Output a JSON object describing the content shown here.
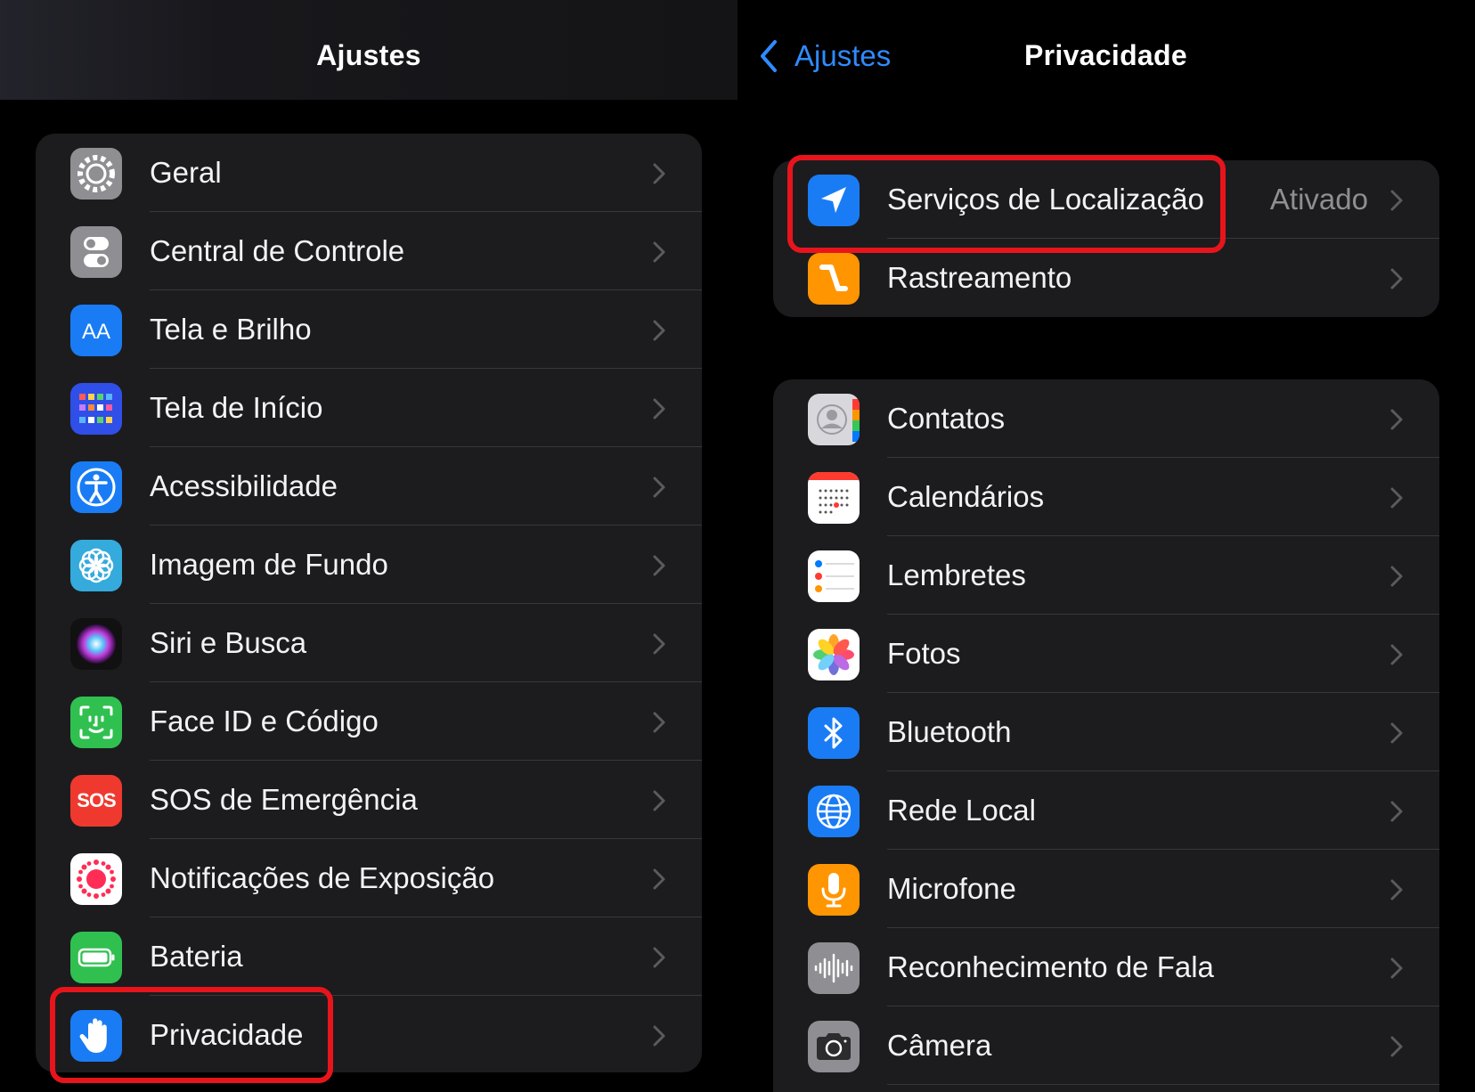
{
  "left": {
    "title": "Ajustes",
    "rows": [
      {
        "label": "Geral",
        "icon": "gear-icon"
      },
      {
        "label": "Central de Controle",
        "icon": "toggles-icon"
      },
      {
        "label": "Tela e Brilho",
        "icon": "text-size-icon"
      },
      {
        "label": "Tela de Início",
        "icon": "home-grid-icon"
      },
      {
        "label": "Acessibilidade",
        "icon": "accessibility-icon"
      },
      {
        "label": "Imagem de Fundo",
        "icon": "flower-icon"
      },
      {
        "label": "Siri e Busca",
        "icon": "siri-icon"
      },
      {
        "label": "Face ID e Código",
        "icon": "face-id-icon"
      },
      {
        "label": "SOS de Emergência",
        "icon": "sos-icon",
        "icon_text": "SOS"
      },
      {
        "label": "Notificações de Exposição",
        "icon": "exposure-icon"
      },
      {
        "label": "Bateria",
        "icon": "battery-icon"
      },
      {
        "label": "Privacidade",
        "icon": "hand-icon"
      }
    ]
  },
  "right": {
    "back_label": "Ajustes",
    "title": "Privacidade",
    "group1": [
      {
        "label": "Serviços de Localização",
        "value": "Ativado",
        "icon": "location-arrow-icon"
      },
      {
        "label": "Rastreamento",
        "icon": "tracking-icon"
      }
    ],
    "group2": [
      {
        "label": "Contatos",
        "icon": "contacts-icon"
      },
      {
        "label": "Calendários",
        "icon": "calendar-icon"
      },
      {
        "label": "Lembretes",
        "icon": "reminders-icon"
      },
      {
        "label": "Fotos",
        "icon": "photos-icon"
      },
      {
        "label": "Bluetooth",
        "icon": "bluetooth-icon"
      },
      {
        "label": "Rede Local",
        "icon": "globe-icon"
      },
      {
        "label": "Microfone",
        "icon": "microphone-icon"
      },
      {
        "label": "Reconhecimento de Fala",
        "icon": "waveform-icon"
      },
      {
        "label": "Câmera",
        "icon": "camera-icon"
      }
    ]
  },
  "colors": {
    "accent": "#2f8bff",
    "highlight": "#e8141c",
    "group_bg": "#1c1c1e",
    "separator": "#38383a",
    "secondary_text": "#8e8e93"
  }
}
